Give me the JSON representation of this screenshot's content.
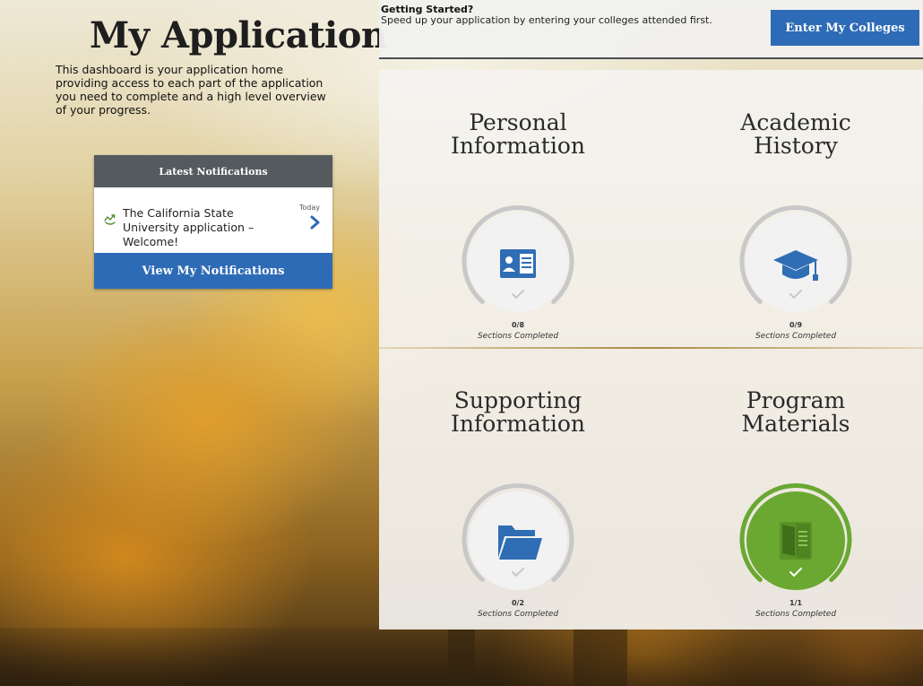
{
  "page": {
    "title": "My Application",
    "intro": "This dashboard is your application home providing access to each part of the application you need to complete and a high level overview of your progress."
  },
  "notifications": {
    "header": "Latest Notifications",
    "items": [
      {
        "text": "The California State University application – Welcome!",
        "time": "Today",
        "icon": "gift-icon"
      }
    ],
    "view_button": "View My Notifications"
  },
  "getting_started": {
    "title": "Getting Started?",
    "description": "Speed up your application by entering your colleges attended first.",
    "button": "Enter My Colleges"
  },
  "sections": [
    {
      "title_line1": "Personal",
      "title_line2": "Information",
      "icon": "id-card-icon",
      "completed": "0/8",
      "label": "Sections Completed",
      "progress": 0,
      "status": "incomplete"
    },
    {
      "title_line1": "Academic",
      "title_line2": "History",
      "icon": "graduation-cap-icon",
      "completed": "0/9",
      "label": "Sections Completed",
      "progress": 0,
      "status": "incomplete"
    },
    {
      "title_line1": "Supporting",
      "title_line2": "Information",
      "icon": "folder-icon",
      "completed": "0/2",
      "label": "Sections Completed",
      "progress": 0,
      "status": "incomplete"
    },
    {
      "title_line1": "Program",
      "title_line2": "Materials",
      "icon": "book-icon",
      "completed": "1/1",
      "label": "Sections Completed",
      "progress": 1,
      "status": "complete"
    }
  ],
  "colors": {
    "primary_blue": "#2e6bb6",
    "icon_blue": "#2f6db5",
    "complete_green": "#6aa832",
    "complete_green_dark": "#5a9228",
    "ring_gray": "#c8c8c8",
    "header_gray": "#555a5f"
  }
}
